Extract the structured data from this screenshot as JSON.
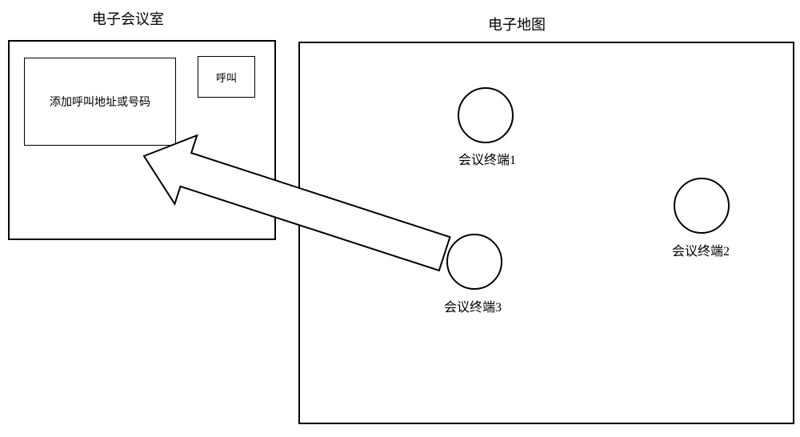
{
  "titles": {
    "conference_room": "电子会议室",
    "map": "电子地图"
  },
  "conference_room": {
    "input_placeholder": "添加呼叫地址或号码",
    "call_button": "呼叫"
  },
  "map": {
    "nodes": [
      {
        "id": "terminal1",
        "label": "会议终端1"
      },
      {
        "id": "terminal2",
        "label": "会议终端2"
      },
      {
        "id": "terminal3",
        "label": "会议终端3"
      }
    ]
  },
  "arrow": {
    "description": "drag-terminal-into-conference-room"
  }
}
